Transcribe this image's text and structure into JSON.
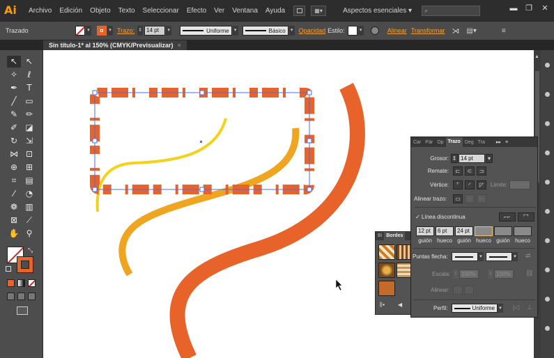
{
  "app": {
    "logo": "Ai"
  },
  "menubar": {
    "items": [
      "Archivo",
      "Edición",
      "Objeto",
      "Texto",
      "Seleccionar",
      "Efecto",
      "Ver",
      "Ventana",
      "Ayuda"
    ],
    "workspace": "Aspectos esenciales ▾"
  },
  "control_bar": {
    "selection_type": "Trazado",
    "stroke_link": "Trazo:",
    "stroke_weight": "14 pt",
    "profile_label": "Uniforme",
    "brush_label": "Básico",
    "opacity_link": "Opacidad",
    "style_label": "Estilo:",
    "align_link": "Alinear",
    "transform_link": "Transformar"
  },
  "document_tab": {
    "title": "Sin título-1* al 150% (CMYK/Previsualizar)",
    "close": "×"
  },
  "brushes_panel": {
    "tabs": [
      "Bi",
      "Bordes"
    ]
  },
  "stroke_panel": {
    "tabs": [
      "Car",
      "Pár",
      "Op",
      "Trazo",
      "Deg",
      "Tra"
    ],
    "weight_label": "Grosor:",
    "weight_value": "14 pt",
    "cap_label": "Remate:",
    "corner_label": "Vértice:",
    "limit_label": "Límite:",
    "align_label": "Alinear trazo:",
    "dashed_checkbox": "✓ Línea discontinua",
    "dash_values": [
      "12 pt",
      "6 pt",
      "24 pt",
      "",
      "",
      ""
    ],
    "dash_labels": [
      "guión",
      "hueco",
      "guión",
      "hueco",
      "guión",
      "hueco"
    ],
    "arrowheads_label": "Puntas flecha:",
    "scale_label": "Escala:",
    "scale_value_1": "100%",
    "scale_value_2": "100%",
    "align_arrows_label": "Alinear:",
    "profile_label": "Perfil:",
    "profile_value": "Uniforme"
  },
  "colors": {
    "accent": "#e8632a",
    "yellow": "#f5d11a",
    "orange_light": "#f0a520",
    "selection": "#4a6cf0",
    "workspace_bg": "#323232"
  }
}
